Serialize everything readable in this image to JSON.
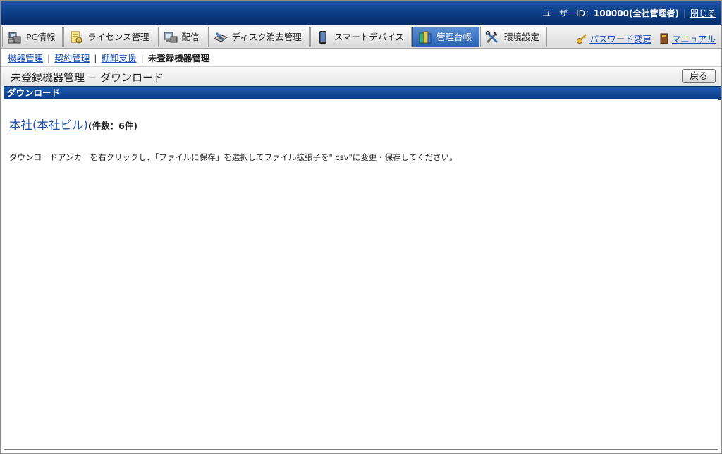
{
  "header": {
    "user_label": "ユーザーID：",
    "user_value": "100000(全社管理者)",
    "close_label": "閉じる"
  },
  "tabs": [
    {
      "label": "PC情報",
      "icon": "pc-icon"
    },
    {
      "label": "ライセンス管理",
      "icon": "license-icon"
    },
    {
      "label": "配信",
      "icon": "distribution-icon"
    },
    {
      "label": "ディスク消去管理",
      "icon": "disk-erase-icon"
    },
    {
      "label": "スマートデバイス",
      "icon": "smartphone-icon"
    },
    {
      "label": "管理台帳",
      "icon": "ledger-icon",
      "active": true
    },
    {
      "label": "環境設定",
      "icon": "tools-icon"
    }
  ],
  "right_links": {
    "password_label": "パスワード変更",
    "manual_label": "マニュアル"
  },
  "breadcrumb": {
    "items": [
      "機器管理",
      "契約管理",
      "棚卸支援"
    ],
    "current": "未登録機器管理"
  },
  "page": {
    "title": "未登録機器管理 − ダウンロード",
    "back_label": "戻る"
  },
  "section": {
    "title": "ダウンロード",
    "file_link": "本社(本社ビル)",
    "file_count": "(件数：6件)",
    "instructions": "ダウンロードアンカーを右クリックし、「ファイルに保存」を選択してファイル拡張子を\".csv\"に変更・保存してください。"
  },
  "colors": {
    "header_blue": "#0e3f88",
    "active_tab": "#2a63b5",
    "link": "#1a4fb0"
  }
}
